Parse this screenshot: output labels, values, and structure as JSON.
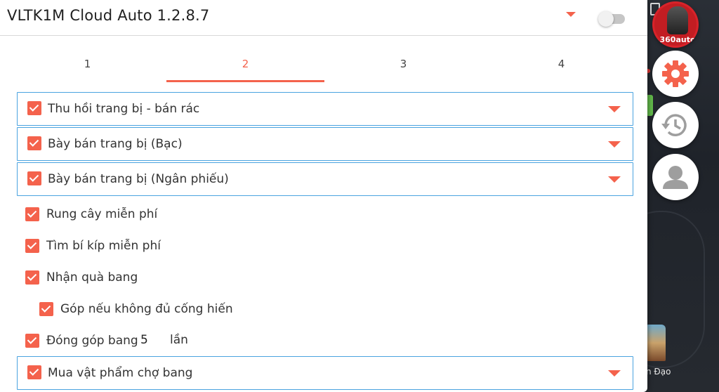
{
  "app": {
    "title": "VLTK1M Cloud Auto 1.2.8.7"
  },
  "tabs": [
    {
      "label": "1",
      "active": false
    },
    {
      "label": "2",
      "active": true
    },
    {
      "label": "3",
      "active": false
    },
    {
      "label": "4",
      "active": false
    }
  ],
  "options": {
    "recall_items": {
      "label": "Thu hồi trang bị - bán rác",
      "checked": true
    },
    "sell_silver": {
      "label": "Bày bán trang bị (Bạc)",
      "checked": true
    },
    "sell_notes": {
      "label": "Bày bán trang bị (Ngân phiếu)",
      "checked": true
    },
    "shake_tree": {
      "label": "Rung cây miễn phí",
      "checked": true
    },
    "find_secret": {
      "label": "Tìm bí kíp miễn phí",
      "checked": true
    },
    "guild_gift": {
      "label": "Nhận quà bang",
      "checked": true
    },
    "contribute_if_short": {
      "label": "Góp nếu không đủ cống hiến",
      "checked": true
    },
    "guild_donate": {
      "label": "Đóng góp bang",
      "checked": true,
      "count": "5",
      "unit": "lần"
    },
    "guild_market": {
      "label": "Mua vật phẩm chợ bang",
      "checked": true
    }
  },
  "sidebar": {
    "logo_text": "360auto",
    "buttons": [
      "logo-360auto",
      "settings",
      "history",
      "account"
    ]
  },
  "background": {
    "partial_text": "n Đạo"
  },
  "colors": {
    "accent": "#f4624c",
    "border_blue": "#4aa3e0",
    "logo_red": "#d8232a"
  }
}
